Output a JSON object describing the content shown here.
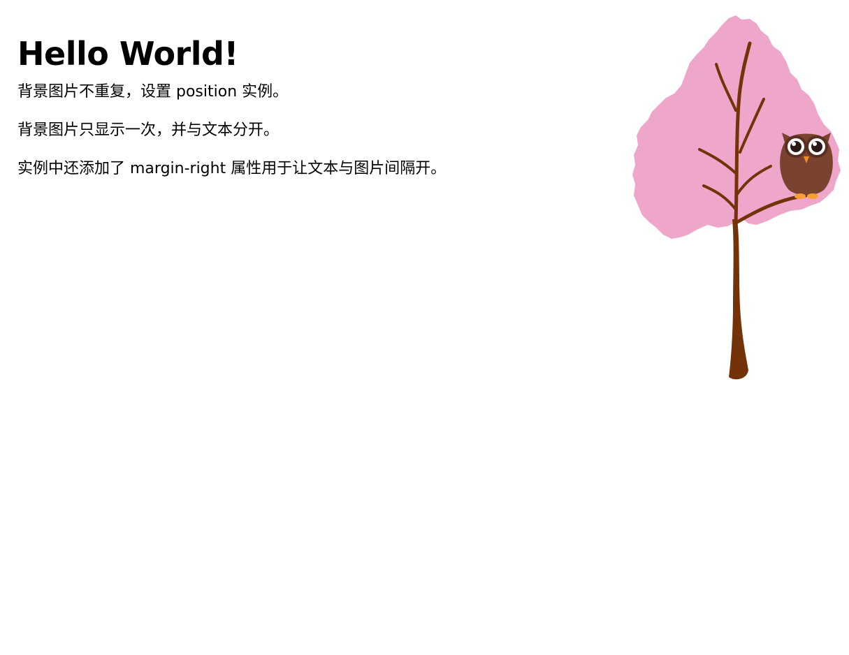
{
  "heading": "Hello World!",
  "paragraphs": [
    "背景图片不重复，设置 position 实例。",
    "背景图片只显示一次，并与文本分开。",
    "实例中还添加了 margin-right 属性用于让文本与图片间隔开。"
  ],
  "illustration": {
    "subject": "tree-with-owl",
    "colors": {
      "foliage": "#EEA7CB",
      "trunk": "#743208",
      "owl_body": "#7A4330",
      "owl_eye": "#FFFFFF",
      "owl_beak": "#F58A2A",
      "owl_feet": "#F5A030"
    }
  }
}
